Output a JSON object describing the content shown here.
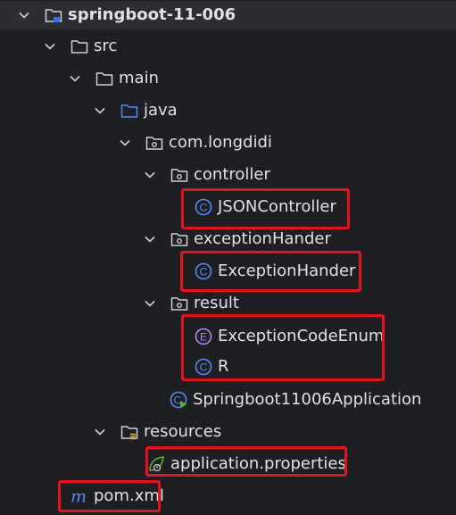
{
  "project_tree": {
    "root": {
      "label": "springboot-11-006",
      "icon": "module-folder-icon"
    },
    "src": {
      "label": "src",
      "icon": "folder-icon"
    },
    "main": {
      "label": "main",
      "icon": "folder-icon"
    },
    "java": {
      "label": "java",
      "icon": "source-root-folder-icon"
    },
    "package": {
      "label": "com.longdidi",
      "icon": "package-icon"
    },
    "controller_pkg": {
      "label": "controller",
      "icon": "package-icon"
    },
    "json_controller": {
      "label": "JSONController",
      "icon": "class-icon"
    },
    "exception_pkg": {
      "label": "exceptionHander",
      "icon": "package-icon"
    },
    "exception_hander": {
      "label": "ExceptionHander",
      "icon": "class-icon"
    },
    "result_pkg": {
      "label": "result",
      "icon": "package-icon"
    },
    "exception_code_enum": {
      "label": "ExceptionCodeEnum",
      "icon": "enum-icon"
    },
    "r_class": {
      "label": "R",
      "icon": "class-icon"
    },
    "application_class": {
      "label": "Springboot11006Application",
      "icon": "spring-boot-class-icon"
    },
    "resources": {
      "label": "resources",
      "icon": "resources-folder-icon"
    },
    "application_properties": {
      "label": "application.properties",
      "icon": "spring-properties-icon"
    },
    "pom": {
      "label": "pom.xml",
      "icon": "maven-icon"
    }
  },
  "colors": {
    "background": "#1e1f22",
    "text": "#dfe1e5",
    "class_icon": "#548af7",
    "enum_icon": "#b189f5",
    "highlight_box": "#e8101a",
    "spring_green": "#5fb832"
  }
}
